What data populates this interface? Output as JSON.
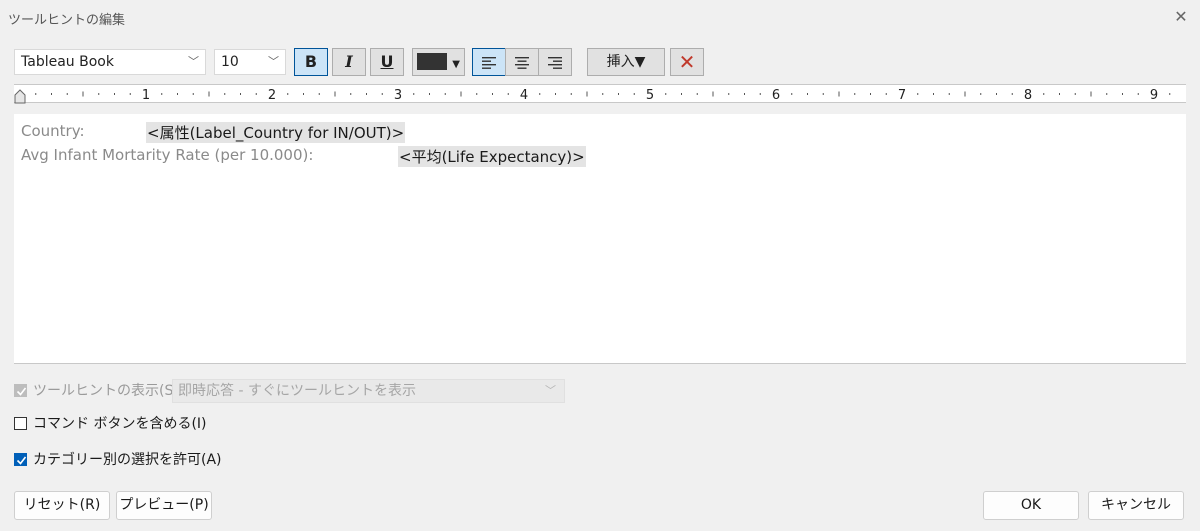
{
  "window": {
    "title": "ツールヒントの編集",
    "close_glyph": "✕"
  },
  "toolbar": {
    "font_family": "Tableau Book",
    "font_size": "10",
    "bold_label": "B",
    "italic_label": "I",
    "underline_label": "U",
    "text_color": "#333333",
    "insert_label": "挿入▼",
    "clear_glyph": "✕"
  },
  "ruler": {
    "numbers": [
      "1",
      "2",
      "3",
      "4",
      "5",
      "6",
      "7",
      "8",
      "9"
    ]
  },
  "editor": {
    "lines": [
      {
        "label": "Country:",
        "field": "<属性(Label_Country for IN/OUT)>"
      },
      {
        "label": "Avg Infant Mortarity Rate (per 10.000):",
        "field": "<平均(Life Expectancy)>"
      }
    ]
  },
  "options": {
    "show_tooltip_label": "ツールヒントの表示(S)",
    "show_tooltip_mode": "即時応答 - すぐにツールヒントを表示",
    "include_command_buttons_label": "コマンド ボタンを含める(I)",
    "allow_category_selection_label": "カテゴリー別の選択を許可(A)"
  },
  "buttons": {
    "reset": "リセット(R)",
    "preview": "プレビュー(P)",
    "ok": "OK",
    "cancel": "キャンセル"
  }
}
